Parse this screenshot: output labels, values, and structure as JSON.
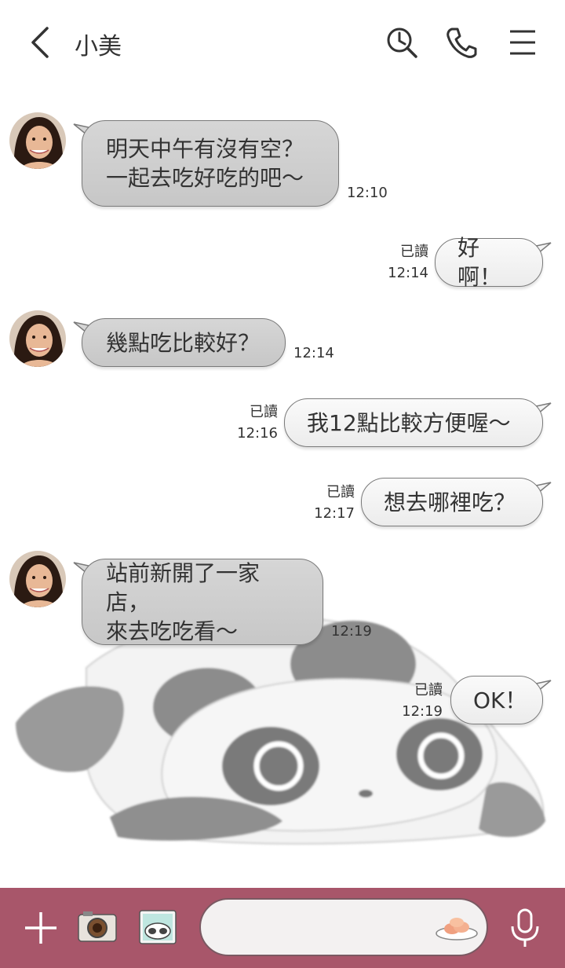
{
  "header": {
    "title": "小美",
    "icons": [
      "back-icon",
      "search-history-icon",
      "phone-icon",
      "menu-icon"
    ]
  },
  "messages": [
    {
      "side": "in",
      "lines": [
        "明天中午有沒有空？",
        "一起去吃好吃的吧～"
      ],
      "time": "12:10"
    },
    {
      "side": "out",
      "lines": [
        "好啊！"
      ],
      "read": "已讀",
      "time": "12:14"
    },
    {
      "side": "in",
      "lines": [
        "幾點吃比較好？"
      ],
      "time": "12:14"
    },
    {
      "side": "out",
      "lines": [
        "我12點比較方便喔～"
      ],
      "read": "已讀",
      "time": "12:16"
    },
    {
      "side": "out",
      "lines": [
        "想去哪裡吃？"
      ],
      "read": "已讀",
      "time": "12:17"
    },
    {
      "side": "in",
      "lines": [
        "站前新開了一家店，",
        "來去吃吃看～"
      ],
      "time": "12:19"
    },
    {
      "side": "out",
      "lines": [
        "OK！"
      ],
      "read": "已讀",
      "time": "12:19"
    }
  ],
  "input": {
    "placeholder": ""
  },
  "colors": {
    "bottom_bar": "#a8566a",
    "incoming_bubble": "#cfcfcf",
    "outgoing_bubble": "#f2f2f2"
  }
}
